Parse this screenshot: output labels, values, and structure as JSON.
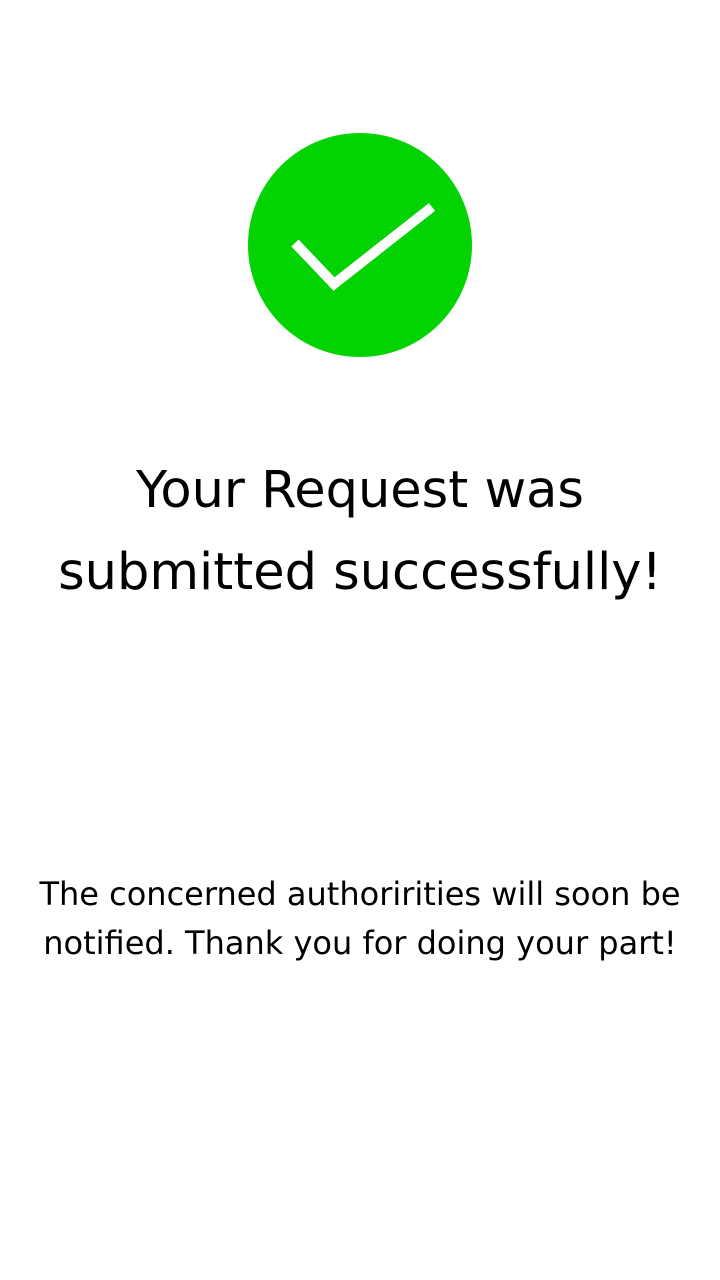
{
  "status": {
    "icon": "checkmark-icon",
    "color": "#03d203"
  },
  "headline": {
    "line1": "Your Request was",
    "line2": "submitted successfully!"
  },
  "message": {
    "line1": "The concerned authoririties will soon be",
    "line2": "notified. Thank you for doing your part!"
  }
}
